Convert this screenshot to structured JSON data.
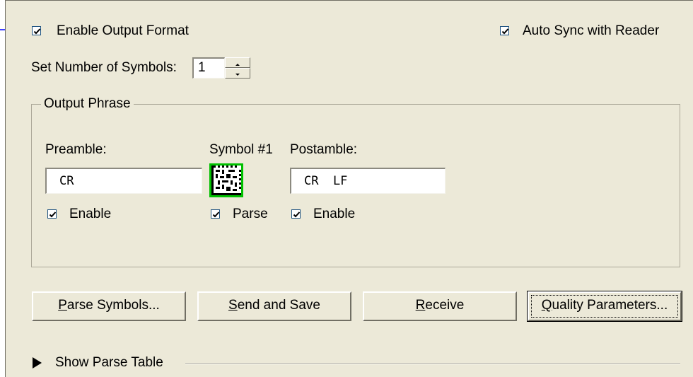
{
  "enable_output_format": {
    "label": "Enable Output Format",
    "checked": true
  },
  "auto_sync": {
    "label": "Auto Sync with Reader",
    "checked": true
  },
  "symbols": {
    "label": "Set Number of Symbols:",
    "value": "1"
  },
  "output_phrase": {
    "title": "Output Phrase",
    "preamble": {
      "label": "Preamble:",
      "value": "CR",
      "enable_label": "Enable",
      "enabled": true
    },
    "symbol": {
      "label": "Symbol #1",
      "parse_label": "Parse",
      "parse": true
    },
    "postamble": {
      "label": "Postamble:",
      "value": "CR  LF",
      "enable_label": "Enable",
      "enabled": true
    }
  },
  "buttons": {
    "parse_symbols": {
      "mnemonic": "P",
      "rest": "arse Symbols..."
    },
    "send_and_save": {
      "mnemonic": "S",
      "rest": "end and Save"
    },
    "receive": {
      "mnemonic": "R",
      "rest": "eceive"
    },
    "quality_parameters": {
      "mnemonic": "Q",
      "rest": "uality Parameters..."
    }
  },
  "show_parse_table": {
    "label": "Show Parse Table"
  },
  "colors": {
    "panel_bg": "#ece9d8",
    "callout_arrow": "#0000ff",
    "symbol_border": "#00c000"
  }
}
